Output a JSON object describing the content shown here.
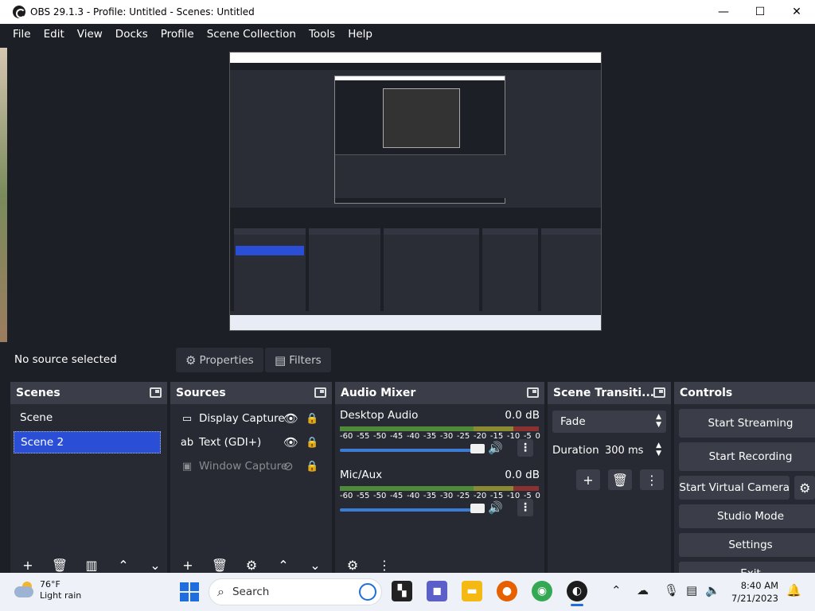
{
  "window": {
    "title": "OBS 29.1.3 - Profile: Untitled - Scenes: Untitled",
    "minimize": "—",
    "maximize": "☐",
    "close": "✕"
  },
  "menu": [
    "File",
    "Edit",
    "View",
    "Docks",
    "Profile",
    "Scene Collection",
    "Tools",
    "Help"
  ],
  "source_toolbar": {
    "status": "No source selected",
    "properties_label": "Properties",
    "filters_label": "Filters"
  },
  "scenes_dock": {
    "title": "Scenes",
    "items": [
      "Scene",
      "Scene 2"
    ],
    "selected": "Scene 2"
  },
  "sources_dock": {
    "title": "Sources",
    "items": [
      {
        "name": "Display Capture",
        "visible": true
      },
      {
        "name": "Text (GDI+)",
        "visible": true
      },
      {
        "name": "Window Capture",
        "visible": false
      }
    ]
  },
  "audio_mixer": {
    "title": "Audio Mixer",
    "channels": [
      {
        "name": "Desktop Audio",
        "level": "0.0 dB"
      },
      {
        "name": "Mic/Aux",
        "level": "0.0 dB"
      }
    ],
    "scale": [
      "-60",
      "-55",
      "-50",
      "-45",
      "-40",
      "-35",
      "-30",
      "-25",
      "-20",
      "-15",
      "-10",
      "-5",
      "0"
    ]
  },
  "transitions_dock": {
    "title": "Scene Transiti...",
    "transition": "Fade",
    "duration_label": "Duration",
    "duration_value": "300 ms"
  },
  "controls_dock": {
    "title": "Controls",
    "start_streaming": "Start Streaming",
    "start_recording": "Start Recording",
    "start_virtual_camera": "Start Virtual Camera",
    "studio_mode": "Studio Mode",
    "settings": "Settings",
    "exit": "Exit"
  },
  "taskbar": {
    "temperature": "76°F",
    "weather": "Light rain",
    "search_placeholder": "Search",
    "time": "8:40 AM",
    "date": "7/21/2023"
  },
  "colors": {
    "background": "#1d1f26",
    "dock": "#272a33",
    "dock_header": "#3b3e48",
    "selection": "#2a4fd6"
  }
}
